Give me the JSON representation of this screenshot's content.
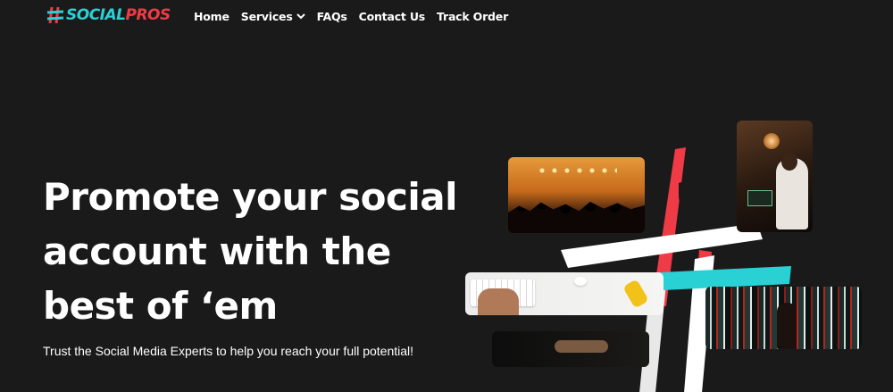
{
  "brand": {
    "name_part1": "SOCIAL",
    "name_part2": "PROS",
    "color_primary": "#2ad1d4",
    "color_accent": "#ef3b45"
  },
  "nav": {
    "items": [
      {
        "label": "Home"
      },
      {
        "label": "Services",
        "has_dropdown": true,
        "icon": "chevron-down-icon"
      },
      {
        "label": "FAQs"
      },
      {
        "label": "Contact Us"
      },
      {
        "label": "Track Order"
      }
    ]
  },
  "hero": {
    "title_line1": "Promote your social",
    "title_line2": "account with the",
    "title_line3": "best of ‘em",
    "subtitle": "Trust the Social Media Experts to help you reach your full potential!"
  },
  "colors": {
    "background": "#1b1a1b",
    "text": "#ffffff",
    "brush_red": "#ef3b45",
    "brush_cyan": "#2ad1d4",
    "brush_white": "#ffffff"
  }
}
